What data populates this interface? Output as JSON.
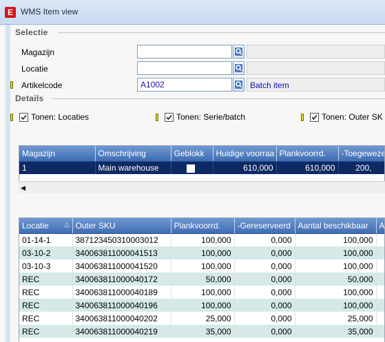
{
  "window": {
    "title": "WMS Item view",
    "app_icon_letter": "E"
  },
  "selectie": {
    "header": "Selectie",
    "fields": [
      {
        "label": "Magazijn",
        "value": "",
        "description": ""
      },
      {
        "label": "Locatie",
        "value": "",
        "description": ""
      },
      {
        "label": "Artikelcode",
        "value": "A1002",
        "description": "Batch item"
      }
    ]
  },
  "details": {
    "header": "Details",
    "checks": [
      {
        "label": "Tonen: Locaties",
        "checked": true
      },
      {
        "label": "Tonen: Serie/batch",
        "checked": true
      },
      {
        "label": "Tonen: Outer SK",
        "checked": true
      }
    ]
  },
  "grid1": {
    "columns": [
      "Magazijn",
      "Omschrijving",
      "Geblokk",
      "Huidige voorraa",
      "Plankvoorrd.",
      "-Toegeweze"
    ],
    "rows": [
      [
        "1",
        "Main warehouse",
        "",
        "610,000",
        "610,000",
        "200,"
      ]
    ]
  },
  "grid2": {
    "columns": [
      "Locatie",
      "Outer SKU",
      "Plankvoorrd.",
      "-Gereserveerd",
      "Aantal beschikbaar",
      "A"
    ],
    "rows": [
      [
        "01-14-1",
        "387123450310003012",
        "100,000",
        "0,000",
        "100,000"
      ],
      [
        "03-10-2",
        "340063811000041513",
        "100,000",
        "0,000",
        "100,000"
      ],
      [
        "03-10-3",
        "340063811000041520",
        "100,000",
        "0,000",
        "100,000"
      ],
      [
        "REC",
        "340063811000040172",
        "50,000",
        "0,000",
        "50,000"
      ],
      [
        "REC",
        "340063811000040189",
        "100,000",
        "0,000",
        "100,000"
      ],
      [
        "REC",
        "340063811000040196",
        "100,000",
        "0,000",
        "100,000"
      ],
      [
        "REC",
        "340063811000040202",
        "25,000",
        "0,000",
        "25,000"
      ],
      [
        "REC",
        "340063811000040219",
        "35,000",
        "0,000",
        "35,000"
      ]
    ]
  },
  "colors": {
    "header_blue": "#3f6db3",
    "selected_row": "#0e2a64",
    "alt_row": "#d5e9e9",
    "app_icon": "#d4141c"
  }
}
